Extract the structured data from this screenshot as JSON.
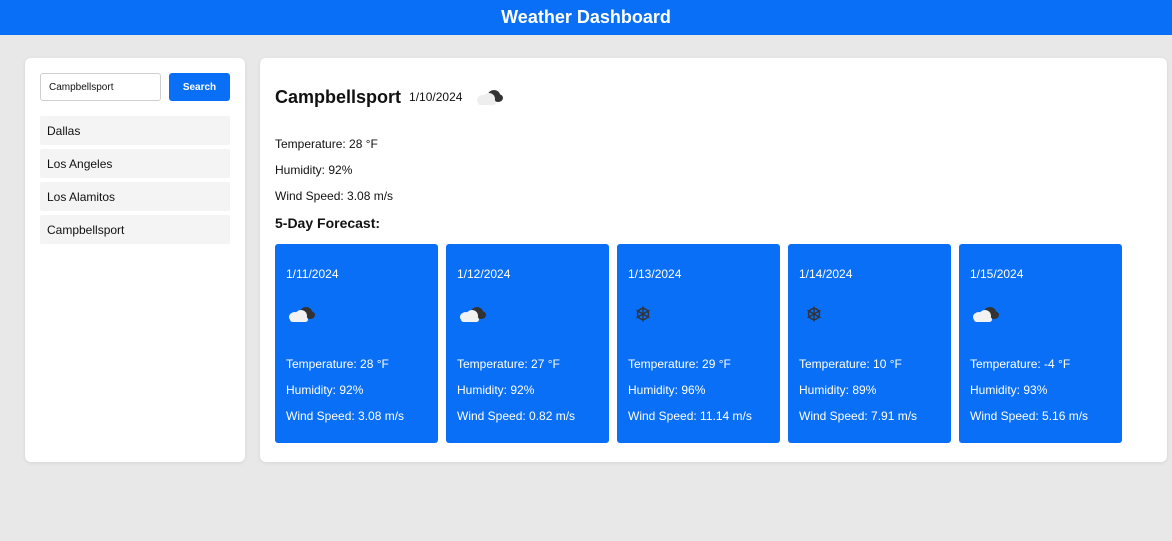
{
  "header": {
    "title": "Weather Dashboard"
  },
  "search": {
    "value": "Campbellsport",
    "button_label": "Search"
  },
  "history": [
    "Dallas",
    "Los Angeles",
    "Los Alamitos",
    "Campbellsport"
  ],
  "current": {
    "city": "Campbellsport",
    "date": "1/10/2024",
    "icon": "cloudy-icon",
    "temperature": "Temperature: 28 °F",
    "humidity": "Humidity: 92%",
    "wind": "Wind Speed: 3.08 m/s"
  },
  "forecast_title": "5-Day Forecast:",
  "forecast": [
    {
      "date": "1/11/2024",
      "icon": "cloudy-icon",
      "temperature": "Temperature: 28 °F",
      "humidity": "Humidity: 92%",
      "wind": "Wind Speed: 3.08 m/s"
    },
    {
      "date": "1/12/2024",
      "icon": "cloudy-icon",
      "temperature": "Temperature: 27 °F",
      "humidity": "Humidity: 92%",
      "wind": "Wind Speed: 0.82 m/s"
    },
    {
      "date": "1/13/2024",
      "icon": "snow-icon",
      "temperature": "Temperature: 29 °F",
      "humidity": "Humidity: 96%",
      "wind": "Wind Speed: 11.14 m/s"
    },
    {
      "date": "1/14/2024",
      "icon": "snow-icon",
      "temperature": "Temperature: 10 °F",
      "humidity": "Humidity: 89%",
      "wind": "Wind Speed: 7.91 m/s"
    },
    {
      "date": "1/15/2024",
      "icon": "cloudy-icon",
      "temperature": "Temperature: -4 °F",
      "humidity": "Humidity: 93%",
      "wind": "Wind Speed: 5.16 m/s"
    }
  ],
  "colors": {
    "accent": "#0a6ff7",
    "background": "#e8e8e8"
  }
}
